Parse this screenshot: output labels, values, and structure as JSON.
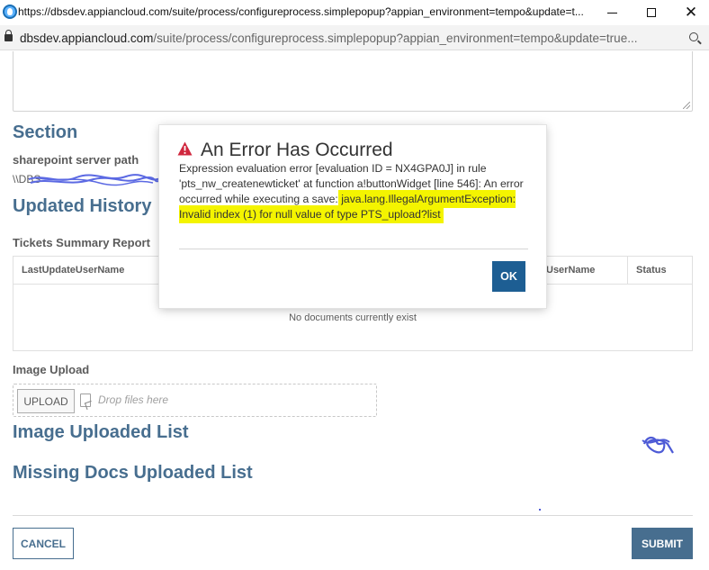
{
  "browser": {
    "title": "https://dbsdev.appiancloud.com/suite/process/configureprocess.simplepopup?appian_environment=tempo&update=t...",
    "address_host": "dbsdev.appiancloud.com",
    "address_path": "/suite/process/configureprocess.simplepopup?appian_environment=tempo&update=true..."
  },
  "form": {
    "section_title": "Section",
    "sharepoint_label": "sharepoint server path",
    "sharepoint_value": "\\\\DBS",
    "updated_history_title": "Updated History",
    "tickets_label": "Tickets Summary Report",
    "grid": {
      "columns": [
        "LastUpdateUserName",
        "UserName",
        "Status"
      ],
      "empty_text": "No documents currently exist"
    },
    "image_upload_label": "Image Upload",
    "upload_button": "UPLOAD",
    "drop_placeholder": "Drop files here",
    "image_uploaded_title": "Image Uploaded List",
    "missing_docs_title": "Missing Docs Uploaded List",
    "cancel_button": "CANCEL",
    "submit_button": "SUBMIT"
  },
  "modal": {
    "title": "An Error Has Occurred",
    "message_plain": "Expression evaluation error [evaluation ID = NX4GPA0J] in rule 'pts_nw_createnewticket' at function a!buttonWidget [line 546]: An error occurred while executing a save:",
    "message_highlight": "java.lang.IllegalArgumentException: Invalid index (1) for null value of type PTS_upload?list",
    "ok_button": "OK",
    "icon": "warning-triangle-icon",
    "highlight_color": "#f4f400"
  },
  "colors": {
    "accent": "#1a4a73",
    "error": "#d0273e"
  }
}
